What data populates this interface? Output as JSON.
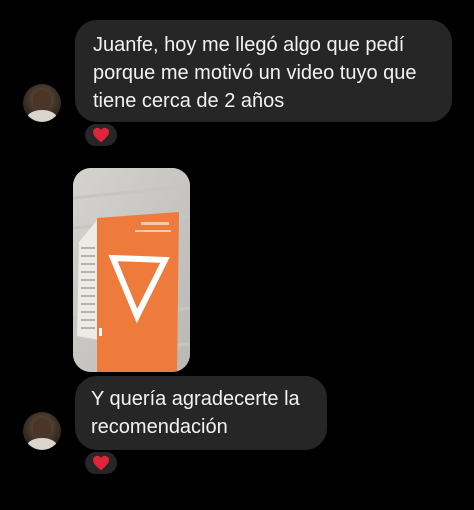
{
  "messages": [
    {
      "text": "Juanfe, hoy me llegó algo que pedí\nporque me motivó un video tuyo que\ntiene cerca de 2 años",
      "reaction": "heart-icon"
    },
    {
      "type": "image",
      "reaction": null
    },
    {
      "text": "Y quería agradecerte la\nrecomendación",
      "reaction": "heart-icon"
    }
  ],
  "colors": {
    "background": "#000000",
    "bubble": "#262626",
    "text": "#f2f2f2",
    "heart": "#e0243a",
    "book_cover": "#ee7a3c"
  }
}
